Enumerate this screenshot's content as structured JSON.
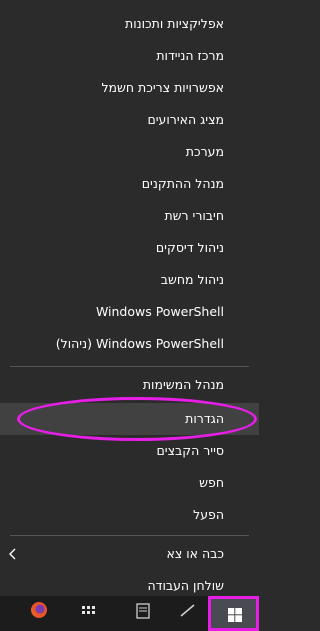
{
  "menu": {
    "items": [
      {
        "label": "אפליקציות ותכונות"
      },
      {
        "label": "מרכז הניידות"
      },
      {
        "label": "אפשרויות צריכת חשמל"
      },
      {
        "label": "מציג האירועים"
      },
      {
        "label": "מערכת"
      },
      {
        "label": "מנהל ההתקנים"
      },
      {
        "label": "חיבורי רשת"
      },
      {
        "label": "ניהול דיסקים"
      },
      {
        "label": "ניהול מחשב"
      },
      {
        "label": "Windows PowerShell"
      },
      {
        "label": "Windows PowerShell (ניהול)"
      },
      {
        "label": "מנהל המשימות"
      },
      {
        "label": "הגדרות",
        "highlighted": true
      },
      {
        "label": "סייר הקבצים"
      },
      {
        "label": "חפש"
      },
      {
        "label": "הפעל"
      },
      {
        "label": "כבה או צא",
        "submenu": true
      },
      {
        "label": "שולחן העבודה"
      }
    ]
  },
  "annotation_color": "#e61ee6",
  "taskbar": {
    "icons": [
      "firefox-icon",
      "calculator-icon",
      "document-icon",
      "pen-icon",
      "windows-start-icon"
    ]
  }
}
